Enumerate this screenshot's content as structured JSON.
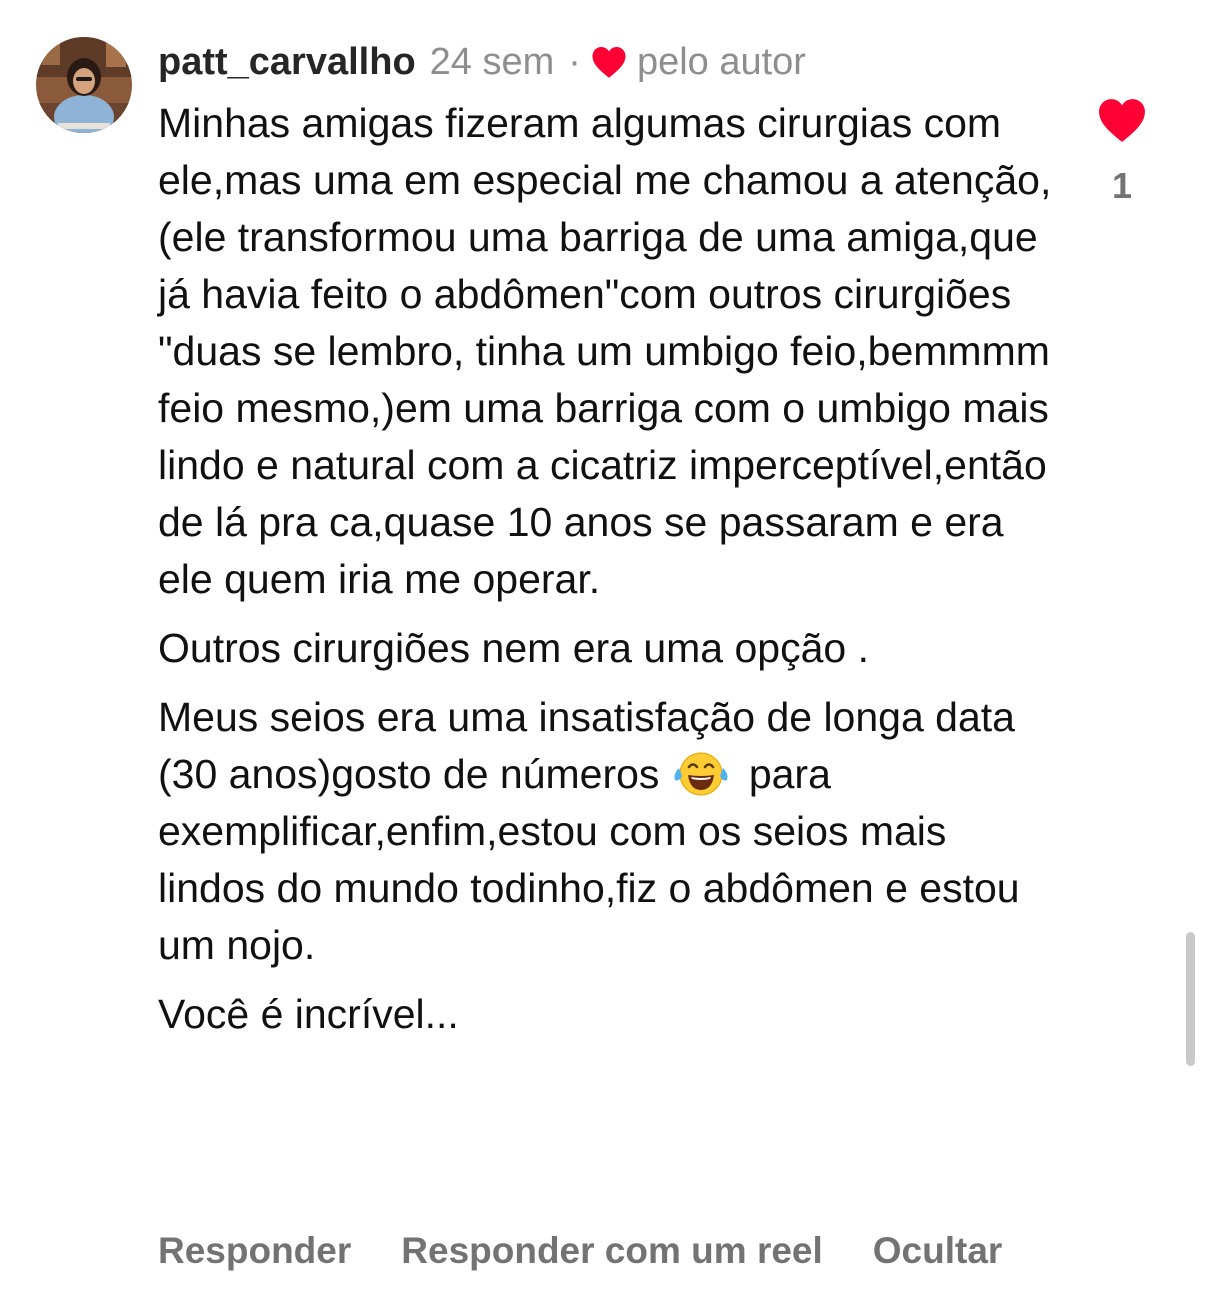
{
  "comment": {
    "username": "patt_carvallho",
    "time": "24 sem",
    "separator": "·",
    "liked_by_author_label": "pelo autor",
    "paragraphs": [
      "Minhas amigas fizeram algumas cirurgias com ele,mas uma em especial me chamou a atenção,(ele transformou uma barriga de uma amiga,que já havia feito o abdômen\"com outros cirurgiões \"duas se lembro, tinha um umbigo feio,bemmmm feio mesmo,)em uma barriga com o umbigo mais lindo e natural com a cicatriz imperceptível,então de lá pra ca,quase 10 anos se passaram e era ele quem iria me operar.",
      "Outros cirurgiões nem era uma opção .",
      "Meus seios era uma insatisfação de longa data (30 anos)gosto de números",
      "Você é incrível..."
    ],
    "paragraph3_after_emoji": "para exemplificar,enfim,estou com os seios mais lindos do mundo todinho,fiz o abdômen e estou um nojo.",
    "emoji": "face-with-tears-of-joy",
    "like_count": "1"
  },
  "actions": {
    "reply": "Responder",
    "reply_with_reel": "Responder com um reel",
    "hide": "Ocultar"
  },
  "colors": {
    "heart": "#ff0034",
    "muted_text": "#8e8e8e",
    "action_text": "#737373"
  }
}
